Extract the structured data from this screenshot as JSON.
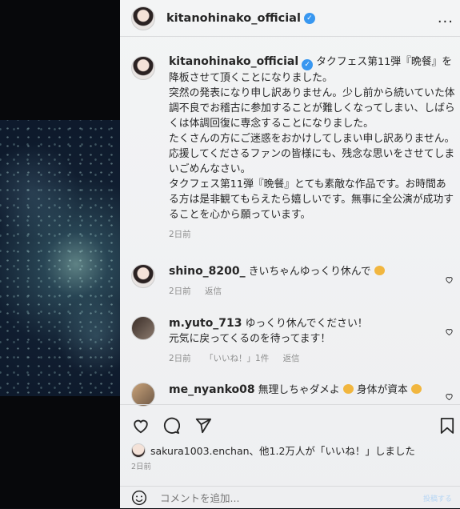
{
  "header": {
    "username": "kitanohinako_official",
    "more_label": "..."
  },
  "caption": {
    "username": "kitanohinako_official",
    "lines": [
      "タクフェス第11弾『晩餐』を降板させて頂くことになりました。",
      "突然の発表になり申し訳ありません。少し前から続いていた体調不良でお稽古に参加することが難しくなってしまい、しばらくは体調回復に専念することになりました。",
      "たくさんの方にご迷惑をおかけしてしまい申し訳ありません。",
      "応援してくださるファンの皆様にも、残念な思いをさせてしまいごめんなさい。",
      "タクフェス第11弾『晩餐』とても素敵な作品です。お時間ある方は是非観てもらえたら嬉しいです。無事に全公演が成功することを心から願っています。"
    ],
    "time": "2日前"
  },
  "comments": [
    {
      "username": "shino_8200_",
      "text": "きいちゃんゆっくり休んで",
      "time": "2日前",
      "reply": "返信",
      "likes": ""
    },
    {
      "username": "m.yuto_713",
      "text": "ゆっくり休んでください！",
      "text2": "元気に戻ってくるのを待ってます！",
      "time": "2日前",
      "reply": "返信",
      "likes": "「いいね！」1件"
    },
    {
      "username": "me_nyanko08",
      "text": "無理しちゃダメよ",
      "text_b": "身体が資本",
      "time": "",
      "reply": "",
      "likes": ""
    }
  ],
  "likes": {
    "text": "sakura1003.enchan、他1.2万人が「いいね！」しました",
    "time": "2日前"
  },
  "add_comment": {
    "placeholder": "コメントを追加...",
    "post_label": "投稿する"
  },
  "colors": {
    "verified": "#3897f0",
    "muted": "#8e8e8e",
    "text": "#262626"
  }
}
